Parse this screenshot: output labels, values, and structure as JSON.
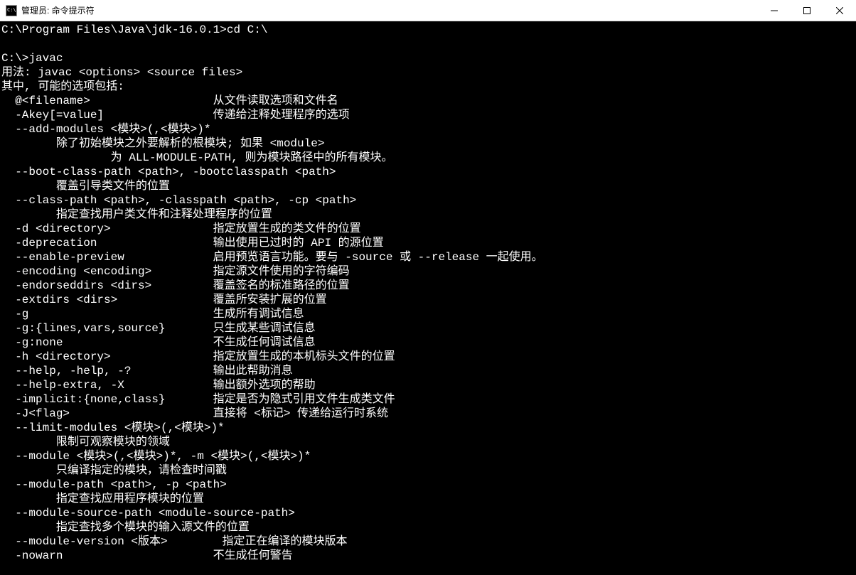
{
  "window": {
    "title": "管理员: 命令提示符"
  },
  "terminal": {
    "lines": [
      "C:\\Program Files\\Java\\jdk-16.0.1>cd C:\\",
      "",
      "C:\\>javac",
      "用法: javac <options> <source files>",
      "其中, 可能的选项包括:",
      "  @<filename>                  从文件读取选项和文件名",
      "  -Akey[=value]                传递给注释处理程序的选项",
      "  --add-modules <模块>(,<模块>)*",
      "        除了初始模块之外要解析的根模块; 如果 <module>",
      "                为 ALL-MODULE-PATH, 则为模块路径中的所有模块。",
      "  --boot-class-path <path>, -bootclasspath <path>",
      "        覆盖引导类文件的位置",
      "  --class-path <path>, -classpath <path>, -cp <path>",
      "        指定查找用户类文件和注释处理程序的位置",
      "  -d <directory>               指定放置生成的类文件的位置",
      "  -deprecation                 输出使用已过时的 API 的源位置",
      "  --enable-preview             启用预览语言功能。要与 -source 或 --release 一起使用。",
      "  -encoding <encoding>         指定源文件使用的字符编码",
      "  -endorseddirs <dirs>         覆盖签名的标准路径的位置",
      "  -extdirs <dirs>              覆盖所安装扩展的位置",
      "  -g                           生成所有调试信息",
      "  -g:{lines,vars,source}       只生成某些调试信息",
      "  -g:none                      不生成任何调试信息",
      "  -h <directory>               指定放置生成的本机标头文件的位置",
      "  --help, -help, -?            输出此帮助消息",
      "  --help-extra, -X             输出额外选项的帮助",
      "  -implicit:{none,class}       指定是否为隐式引用文件生成类文件",
      "  -J<flag>                     直接将 <标记> 传递给运行时系统",
      "  --limit-modules <模块>(,<模块>)*",
      "        限制可观察模块的领域",
      "  --module <模块>(,<模块>)*, -m <模块>(,<模块>)*",
      "        只编译指定的模块，请检查时间戳",
      "  --module-path <path>, -p <path>",
      "        指定查找应用程序模块的位置",
      "  --module-source-path <module-source-path>",
      "        指定查找多个模块的输入源文件的位置",
      "  --module-version <版本>        指定正在编译的模块版本",
      "  -nowarn                      不生成任何警告"
    ]
  }
}
